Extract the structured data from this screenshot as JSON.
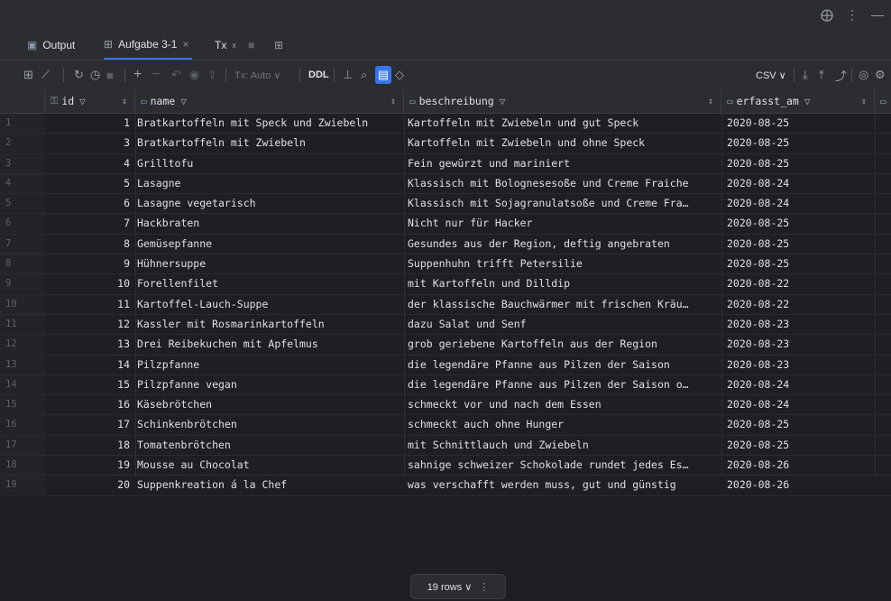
{
  "window": {
    "controls": [
      "⨁",
      "⋮",
      "—"
    ]
  },
  "tabs": [
    {
      "label": "Output",
      "icon": "output-icon"
    },
    {
      "label": "Aufgabe 3-1",
      "icon": "table-icon",
      "close": "×",
      "active": true
    },
    {
      "label": "Tx",
      "icon": "transaction-icon"
    }
  ],
  "toolbar": {
    "tx_mode": "Tx: Auto ∨",
    "ddl": "DDL",
    "export_format": "CSV ∨"
  },
  "columns": [
    {
      "name": "id"
    },
    {
      "name": "name"
    },
    {
      "name": "beschreibung"
    },
    {
      "name": "erfasst_am"
    }
  ],
  "rows": [
    {
      "n": "1",
      "id": "1",
      "name": "Bratkartoffeln mit Speck und Zwiebeln",
      "desc": "Kartoffeln mit Zwiebeln und gut Speck",
      "date": "2020-08-25"
    },
    {
      "n": "2",
      "id": "3",
      "name": "Bratkartoffeln mit Zwiebeln",
      "desc": "Kartoffeln mit Zwiebeln und ohne Speck",
      "date": "2020-08-25"
    },
    {
      "n": "3",
      "id": "4",
      "name": "Grilltofu",
      "desc": "Fein gewürzt und mariniert",
      "date": "2020-08-25"
    },
    {
      "n": "4",
      "id": "5",
      "name": "Lasagne",
      "desc": "Klassisch mit Bolognesesoße und Creme Fraiche",
      "date": "2020-08-24"
    },
    {
      "n": "5",
      "id": "6",
      "name": "Lasagne vegetarisch",
      "desc": "Klassisch mit Sojagranulatsoße und Creme Fra…",
      "date": "2020-08-24"
    },
    {
      "n": "6",
      "id": "7",
      "name": "Hackbraten",
      "desc": "Nicht nur für Hacker",
      "date": "2020-08-25"
    },
    {
      "n": "7",
      "id": "8",
      "name": "Gemüsepfanne",
      "desc": "Gesundes aus der Region, deftig angebraten",
      "date": "2020-08-25"
    },
    {
      "n": "8",
      "id": "9",
      "name": "Hühnersuppe",
      "desc": "Suppenhuhn trifft Petersilie",
      "date": "2020-08-25"
    },
    {
      "n": "9",
      "id": "10",
      "name": "Forellenfilet",
      "desc": "mit Kartoffeln und Dilldip",
      "date": "2020-08-22"
    },
    {
      "n": "10",
      "id": "11",
      "name": "Kartoffel-Lauch-Suppe",
      "desc": "der klassische Bauchwärmer mit frischen Kräu…",
      "date": "2020-08-22"
    },
    {
      "n": "11",
      "id": "12",
      "name": "Kassler mit Rosmarinkartoffeln",
      "desc": "dazu Salat und Senf",
      "date": "2020-08-23"
    },
    {
      "n": "12",
      "id": "13",
      "name": "Drei Reibekuchen mit Apfelmus",
      "desc": "grob geriebene Kartoffeln aus der Region",
      "date": "2020-08-23"
    },
    {
      "n": "13",
      "id": "14",
      "name": "Pilzpfanne",
      "desc": "die legendäre Pfanne aus Pilzen der Saison",
      "date": "2020-08-23"
    },
    {
      "n": "14",
      "id": "15",
      "name": "Pilzpfanne vegan",
      "desc": "die legendäre Pfanne aus Pilzen der Saison o…",
      "date": "2020-08-24"
    },
    {
      "n": "15",
      "id": "16",
      "name": "Käsebrötchen",
      "desc": "schmeckt vor und nach dem Essen",
      "date": "2020-08-24"
    },
    {
      "n": "16",
      "id": "17",
      "name": "Schinkenbrötchen",
      "desc": "schmeckt auch ohne Hunger",
      "date": "2020-08-25"
    },
    {
      "n": "17",
      "id": "18",
      "name": "Tomatenbrötchen",
      "desc": "mit Schnittlauch und Zwiebeln",
      "date": "2020-08-25"
    },
    {
      "n": "18",
      "id": "19",
      "name": "Mousse au Chocolat",
      "desc": "sahnige schweizer Schokolade rundet jedes Es…",
      "date": "2020-08-26"
    },
    {
      "n": "19",
      "id": "20",
      "name": "Suppenkreation á la Chef",
      "desc": "was verschafft werden muss, gut und günstig",
      "date": "2020-08-26"
    }
  ],
  "footer": {
    "rows_label": "19 rows ∨",
    "menu": "⋮"
  },
  "colors": {
    "background": "#1e1f22",
    "panel": "#2b2d30",
    "accent": "#3574f0"
  }
}
